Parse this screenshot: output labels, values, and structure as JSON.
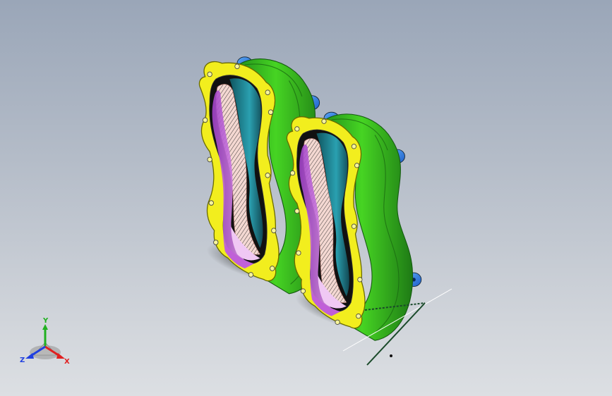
{
  "viewport": {
    "background_top": "#9aa6b8",
    "background_bottom": "#dcdfe3"
  },
  "model": {
    "parts": [
      {
        "name": "flange",
        "color": "#f2ee1e"
      },
      {
        "name": "shell",
        "color": "#3cc41e"
      },
      {
        "name": "mount-tab",
        "color": "#2f7ee0"
      },
      {
        "name": "inner-wall",
        "color": "#1f7f8a"
      },
      {
        "name": "gear-teeth",
        "color": "#f4c6c0"
      },
      {
        "name": "liner",
        "color": "#d080e8"
      }
    ]
  },
  "triad": {
    "x_label": "X",
    "y_label": "Y",
    "z_label": "Z",
    "x_color": "#e02020",
    "y_color": "#20b020",
    "z_color": "#2040e0"
  },
  "icons": [
    "coordinate-triad-icon",
    "sketch-line-icon"
  ]
}
